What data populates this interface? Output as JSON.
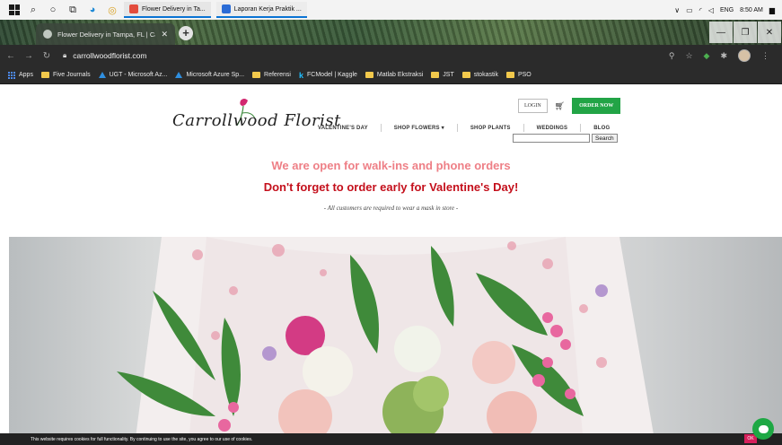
{
  "taskbar": {
    "apps": [
      {
        "title": "Flower Delivery in Ta...",
        "color": "#e34c3c"
      },
      {
        "title": "Laporan Kerja Praktik ...",
        "color": "#2b6cd6"
      }
    ],
    "language": "ENG",
    "time": "8:50 AM"
  },
  "browser": {
    "tab_title": "Flower Delivery in Tampa, FL | Ca",
    "url": "carrollwoodflorist.com",
    "bookmarks": [
      {
        "label": "Apps",
        "kind": "apps"
      },
      {
        "label": "Five Journals",
        "kind": "folder"
      },
      {
        "label": "UGT - Microsoft Az...",
        "kind": "azure"
      },
      {
        "label": "Microsoft Azure Sp...",
        "kind": "azure"
      },
      {
        "label": "Referensi",
        "kind": "folder"
      },
      {
        "label": "FCModel | Kaggle",
        "kind": "kaggle"
      },
      {
        "label": "Matlab Ekstraksi",
        "kind": "folder"
      },
      {
        "label": "JST",
        "kind": "folder"
      },
      {
        "label": "stokastik",
        "kind": "folder"
      },
      {
        "label": "PSO",
        "kind": "folder"
      }
    ]
  },
  "site": {
    "logo_text": "Carrollwood Florist",
    "login_label": "LOGIN",
    "order_label": "ORDER NOW",
    "nav": [
      {
        "label": "VALENTINE'S DAY"
      },
      {
        "label": "SHOP FLOWERS ▾"
      },
      {
        "label": "SHOP PLANTS"
      },
      {
        "label": "WEDDINGS"
      },
      {
        "label": "BLOG"
      }
    ],
    "search_button": "Search",
    "search_placeholder": "",
    "notice_primary": "We are open for walk-ins and phone orders",
    "notice_secondary": "Don't forget to order early for Valentine's Day!",
    "notice_mask": "- All customers are required to wear a mask in store -",
    "cookie_text": "This website requires cookies for full functionality. By continuing to use the site, you agree to our use of cookies.",
    "cookie_ok": "OK",
    "accent_green": "#22a446",
    "accent_pink": "#ee7f86",
    "accent_red": "#c4101c"
  }
}
